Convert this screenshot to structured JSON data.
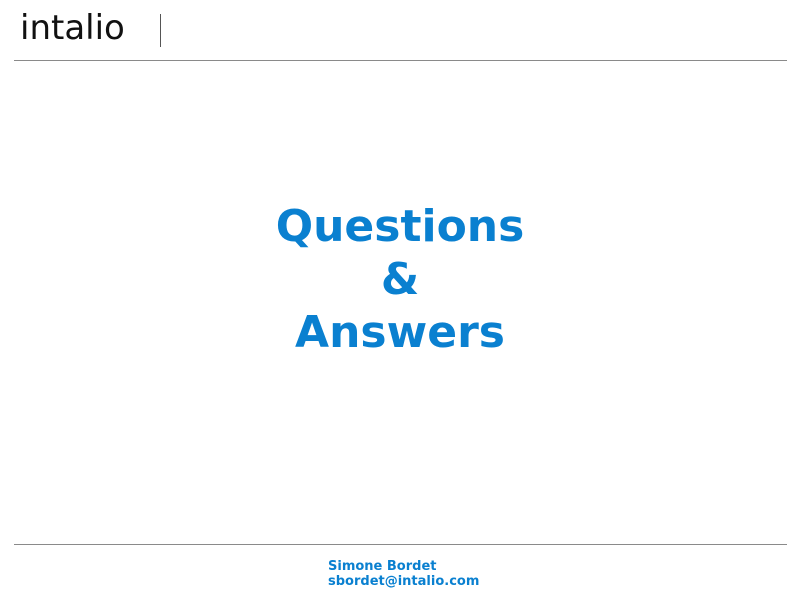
{
  "header": {
    "logo_text": "intalio"
  },
  "main": {
    "title_lines": [
      "Questions",
      "&",
      "Answers"
    ]
  },
  "footer": {
    "author_name": "Simone Bordet",
    "author_email": "sbordet@intalio.com"
  },
  "colors": {
    "accent": "#0a80d0",
    "rule": "#8a8a8a",
    "logo": "#111111"
  }
}
